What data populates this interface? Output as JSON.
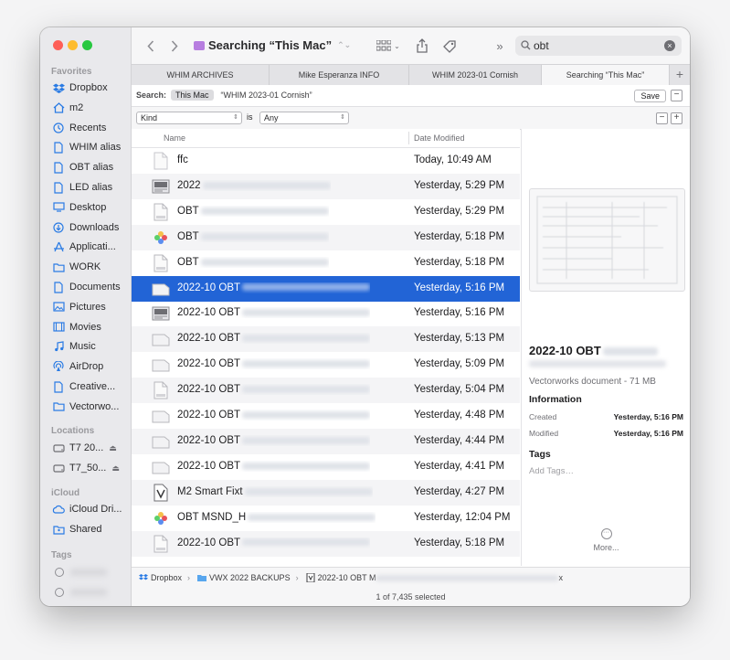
{
  "sidebar": {
    "favorites_heading": "Favorites",
    "favorites": [
      {
        "label": "Dropbox",
        "icon": "dropbox-icon"
      },
      {
        "label": "m2",
        "icon": "home-icon"
      },
      {
        "label": "Recents",
        "icon": "clock-icon"
      },
      {
        "label": "WHIM alias",
        "icon": "document-icon"
      },
      {
        "label": "OBT alias",
        "icon": "document-icon"
      },
      {
        "label": "LED alias",
        "icon": "document-icon"
      },
      {
        "label": "Desktop",
        "icon": "desktop-icon"
      },
      {
        "label": "Downloads",
        "icon": "download-icon"
      },
      {
        "label": "Applicati...",
        "icon": "applications-icon"
      },
      {
        "label": "WORK",
        "icon": "folder-icon"
      },
      {
        "label": "Documents",
        "icon": "document-icon"
      },
      {
        "label": "Pictures",
        "icon": "pictures-icon"
      },
      {
        "label": "Movies",
        "icon": "movies-icon"
      },
      {
        "label": "Music",
        "icon": "music-icon"
      },
      {
        "label": "AirDrop",
        "icon": "airdrop-icon"
      },
      {
        "label": "Creative...",
        "icon": "document-icon"
      },
      {
        "label": "Vectorwo...",
        "icon": "folder-icon"
      }
    ],
    "locations_heading": "Locations",
    "locations": [
      {
        "label": "T7 20...",
        "icon": "drive-icon"
      },
      {
        "label": "T7_50...",
        "icon": "drive-icon"
      }
    ],
    "icloud_heading": "iCloud",
    "icloud": [
      {
        "label": "iCloud Dri...",
        "icon": "cloud-icon"
      },
      {
        "label": "Shared",
        "icon": "shared-folder-icon"
      }
    ],
    "tags_heading": "Tags"
  },
  "toolbar": {
    "title": "Searching “This Mac”",
    "search_value": "obt"
  },
  "tabs": [
    {
      "label": "WHIM ARCHIVES",
      "active": false
    },
    {
      "label": "Mike Esperanza INFO",
      "active": false
    },
    {
      "label": "WHIM 2023-01 Cornish",
      "active": false
    },
    {
      "label": "Searching “This Mac”",
      "active": true
    }
  ],
  "scope": {
    "label": "Search:",
    "this_mac": "This Mac",
    "other": "“WHIM 2023-01 Cornish”",
    "save": "Save"
  },
  "criteria": {
    "attribute": "Kind",
    "operator": "is",
    "value": "Any"
  },
  "list": {
    "col_name": "Name",
    "col_date": "Date Modified",
    "rows": [
      {
        "name": "ffc",
        "blur": false,
        "date": "Today, 10:49 AM",
        "icon": "blank"
      },
      {
        "name": "2022",
        "blur": true,
        "date": "Yesterday, 5:29 PM",
        "icon": "pdf"
      },
      {
        "name": "OBT",
        "blur": true,
        "date": "Yesterday, 5:29 PM",
        "icon": "doc"
      },
      {
        "name": "OBT",
        "blur": true,
        "date": "Yesterday, 5:18 PM",
        "icon": "app"
      },
      {
        "name": "OBT",
        "blur": true,
        "date": "Yesterday, 5:18 PM",
        "icon": "doc"
      },
      {
        "name": "2022-10 OBT",
        "blur": true,
        "date": "Yesterday, 5:16 PM",
        "icon": "vwx",
        "selected": true
      },
      {
        "name": "2022-10 OBT",
        "blur": true,
        "date": "Yesterday, 5:16 PM",
        "icon": "pdf"
      },
      {
        "name": "2022-10 OBT",
        "blur": true,
        "date": "Yesterday, 5:13 PM",
        "icon": "vwx"
      },
      {
        "name": "2022-10 OBT",
        "blur": true,
        "date": "Yesterday, 5:09 PM",
        "icon": "vwx"
      },
      {
        "name": "2022-10 OBT",
        "blur": true,
        "date": "Yesterday, 5:04 PM",
        "icon": "doc"
      },
      {
        "name": "2022-10 OBT",
        "blur": true,
        "date": "Yesterday, 4:48 PM",
        "icon": "vwx"
      },
      {
        "name": "2022-10 OBT",
        "blur": true,
        "date": "Yesterday, 4:44 PM",
        "icon": "vwx"
      },
      {
        "name": "2022-10 OBT",
        "blur": true,
        "date": "Yesterday, 4:41 PM",
        "icon": "vwx"
      },
      {
        "name": "M2 Smart Fixt",
        "blur": true,
        "date": "Yesterday, 4:27 PM",
        "icon": "vwx-doc"
      },
      {
        "name": "OBT MSND_H",
        "blur": true,
        "date": "Yesterday, 12:04 PM",
        "icon": "app"
      },
      {
        "name": "2022-10 OBT",
        "blur": true,
        "date": "Yesterday, 5:18 PM",
        "icon": "doc"
      }
    ]
  },
  "preview": {
    "name": "2022-10 OBT",
    "kind": "Vectorworks document - 71 MB",
    "info_heading": "Information",
    "created_label": "Created",
    "created_value": "Yesterday, 5:16 PM",
    "modified_label": "Modified",
    "modified_value": "Yesterday, 5:16 PM",
    "tags_heading": "Tags",
    "add_tags": "Add Tags…",
    "more": "More..."
  },
  "pathbar": {
    "items": [
      "Dropbox",
      "VWX 2022 BACKUPS",
      "2022-10 OBT M"
    ],
    "trail": "x"
  },
  "status": {
    "text": "1 of 7,435 selected"
  },
  "colors": {
    "accent": "#2264d6",
    "sidebar_icon": "#2a7be4",
    "search_folder": "#b77ee0"
  }
}
